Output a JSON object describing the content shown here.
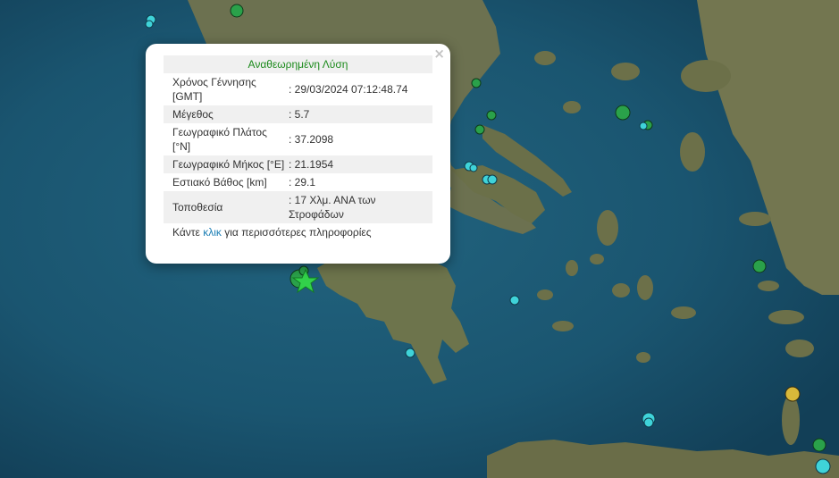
{
  "popup": {
    "header": "Αναθεωρημένη Λύση",
    "close_symbol": "×",
    "rows": [
      {
        "label": "Χρόνος Γέννησης [GMT]",
        "value": ": 29/03/2024 07:12:48.74"
      },
      {
        "label": "Μέγεθος",
        "value": ": 5.7"
      },
      {
        "label": "Γεωγραφικό Πλάτος [°N]",
        "value": ": 37.2098"
      },
      {
        "label": "Γεωγραφικό Μήκος [°E]",
        "value": ": 21.1954"
      },
      {
        "label": "Εστιακό Βάθος [km]",
        "value": ": 29.1"
      },
      {
        "label": "Τοποθεσία",
        "value": ": 17 Χλμ. ΑΝΑ των Στροφάδων"
      }
    ],
    "more_prefix": "Κάντε",
    "more_link": "κλικ",
    "more_suffix": "για περισσότερες πληροφορίες"
  },
  "colors": {
    "sea": "#1d5a76",
    "land": "#6f7450",
    "marker_green": "#2aa14a",
    "marker_cyan": "#3fd3d9",
    "marker_yellow": "#d8b83a",
    "star": "#32d14a"
  },
  "markers": [
    {
      "color": "green",
      "label": "event"
    },
    {
      "color": "cyan",
      "label": "event"
    },
    {
      "color": "yellow",
      "label": "event"
    },
    {
      "type": "star-icon",
      "label": "selected event"
    }
  ]
}
